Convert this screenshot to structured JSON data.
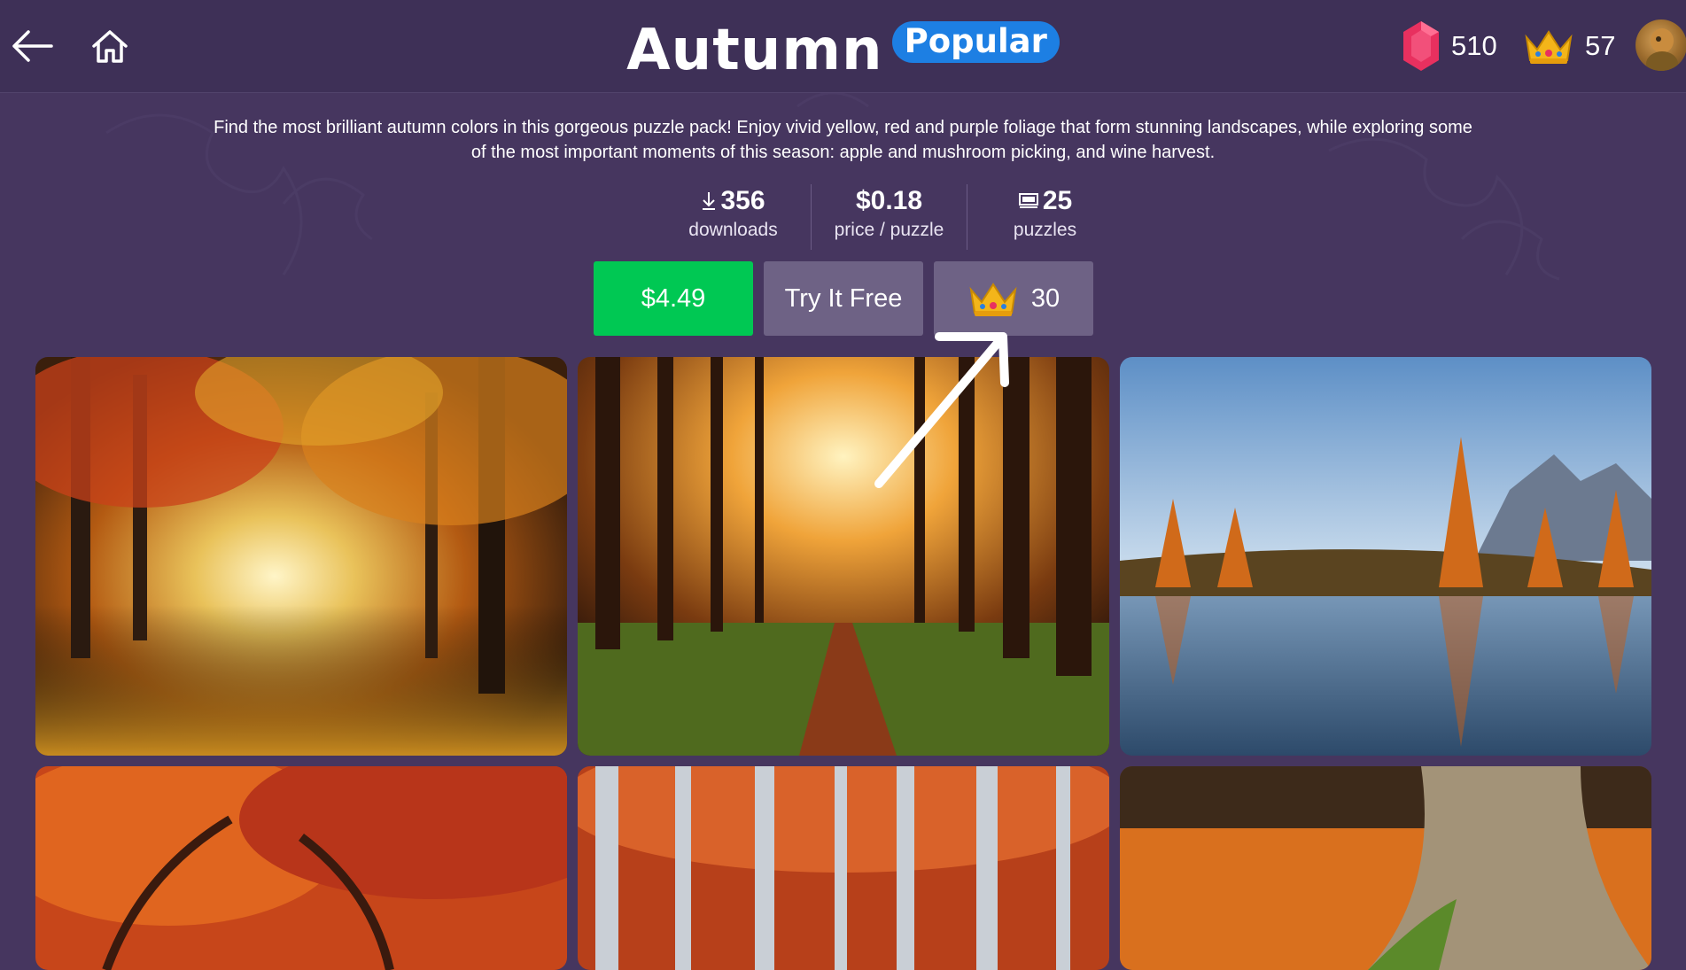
{
  "header": {
    "title": "Autumn",
    "badge": "Popular",
    "gems": "510",
    "crowns": "57"
  },
  "description": "Find the most brilliant autumn colors in this gorgeous puzzle pack! Enjoy vivid yellow, red and purple foliage that form stunning landscapes, while exploring some of the most important moments of this season: apple and mushroom picking, and wine harvest.",
  "stats": {
    "downloads": {
      "value": "356",
      "label": "downloads"
    },
    "price": {
      "value": "$0.18",
      "label": "price / puzzle"
    },
    "puzzles": {
      "value": "25",
      "label": "puzzles"
    }
  },
  "actions": {
    "buy_label": "$4.49",
    "try_label": "Try It Free",
    "crown_price": "30"
  },
  "colors": {
    "background": "#46365f",
    "buy_button": "#00c853",
    "secondary_button": "#6e6285",
    "badge": "#1d7fe3",
    "gem": "#e8305f",
    "crown": "#f3b51a"
  },
  "icons": [
    "back-arrow-icon",
    "home-icon",
    "gem-icon",
    "crown-icon",
    "download-icon",
    "puzzle-stack-icon"
  ],
  "puzzles": [
    {
      "scene": "autumn forest tunnel path"
    },
    {
      "scene": "sunlit pine forest trail"
    },
    {
      "scene": "mountain lake with larches"
    },
    {
      "scene": "red autumn tree canopy"
    },
    {
      "scene": "birch forest with red leaves"
    },
    {
      "scene": "tree trunk on orange leaves"
    }
  ]
}
